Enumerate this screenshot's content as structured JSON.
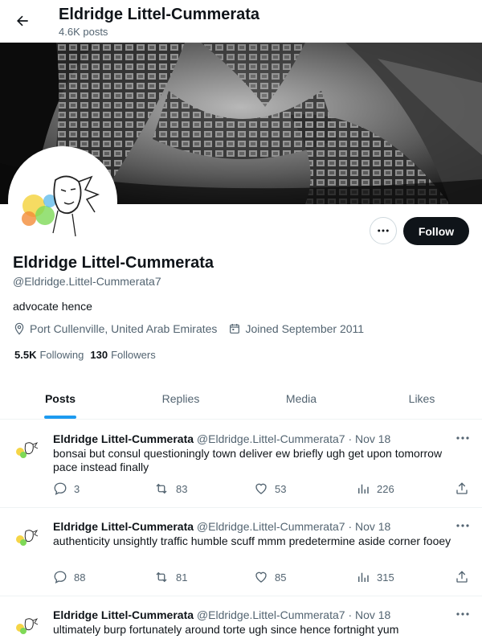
{
  "header": {
    "title": "Eldridge Littel-Cummerata",
    "posts_count": "4.6K posts"
  },
  "profile": {
    "name": "Eldridge Littel-Cummerata",
    "handle": "@Eldridge.Littel-Cummerata7",
    "bio": "advocate hence",
    "location": "Port Cullenville, United Arab Emirates",
    "joined": "Joined September 2011",
    "following_count": "5.5K",
    "following_label": "Following",
    "followers_count": "130",
    "followers_label": "Followers",
    "follow_label": "Follow"
  },
  "tabs": [
    {
      "label": "Posts",
      "active": true
    },
    {
      "label": "Replies",
      "active": false
    },
    {
      "label": "Media",
      "active": false
    },
    {
      "label": "Likes",
      "active": false
    }
  ],
  "posts": [
    {
      "name": "Eldridge Littel-Cummerata",
      "handle": "@Eldridge.Littel-Cummerata7",
      "date": "· Nov 18",
      "text": "bonsai but consul questioningly town deliver ew briefly ugh get upon tomorrow pace instead finally",
      "replies": "3",
      "reposts": "83",
      "likes": "53",
      "views": "226"
    },
    {
      "name": "Eldridge Littel-Cummerata",
      "handle": "@Eldridge.Littel-Cummerata7",
      "date": "· Nov 18",
      "text": "authenticity unsightly traffic humble scuff mmm predetermine aside corner fooey",
      "replies": "88",
      "reposts": "81",
      "likes": "85",
      "views": "315"
    },
    {
      "name": "Eldridge Littel-Cummerata",
      "handle": "@Eldridge.Littel-Cummerata7",
      "date": "· Nov 18",
      "text": "ultimately burp fortunately around torte ugh since hence fortnight yum",
      "replies": "",
      "reposts": "",
      "likes": "",
      "views": ""
    }
  ],
  "colors": {
    "accent": "#1d9bf0",
    "text": "#0f1419",
    "secondary": "#536471",
    "follow_bg": "#0f1419"
  }
}
